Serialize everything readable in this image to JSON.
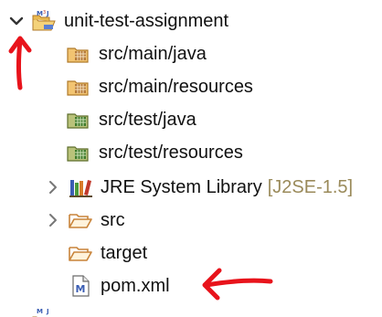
{
  "tree": {
    "project": {
      "label": "unit-test-assignment"
    },
    "items": [
      {
        "label": "src/main/java"
      },
      {
        "label": "src/main/resources"
      },
      {
        "label": "src/test/java"
      },
      {
        "label": "src/test/resources"
      },
      {
        "label": "JRE System Library",
        "hint": "[J2SE-1.5]"
      },
      {
        "label": "src"
      },
      {
        "label": "target"
      },
      {
        "label": "pom.xml"
      }
    ]
  },
  "colors": {
    "annotation_red": "#e8131b",
    "package_orange": "#c8843a",
    "package_green": "#3f7a2b",
    "folder_outline": "#c8843a",
    "pom_blue": "#3a5db3"
  },
  "icons": {
    "project": "maven-project-icon",
    "main_pkg": "source-folder-icon",
    "test_pkg": "test-source-folder-icon",
    "library": "library-icon",
    "folder": "folder-icon",
    "pom": "maven-pom-file-icon",
    "expanded": "chevron-down-icon",
    "collapsed": "chevron-right-icon"
  }
}
